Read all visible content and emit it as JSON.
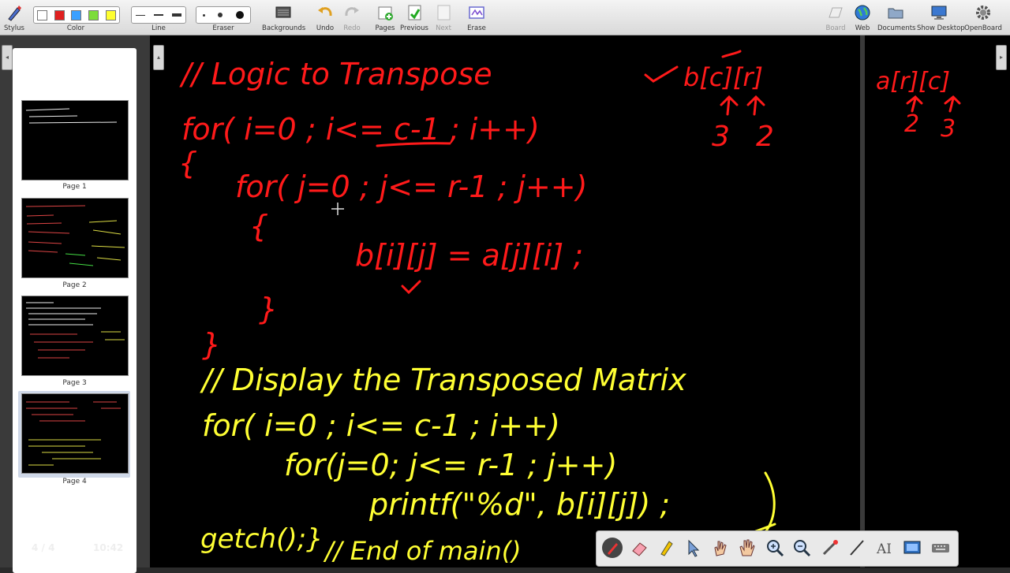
{
  "toolbar": {
    "stylus_label": "Stylus",
    "color_label": "Color",
    "line_label": "Line",
    "eraser_label": "Eraser",
    "backgrounds_label": "Backgrounds",
    "undo_label": "Undo",
    "redo_label": "Redo",
    "pages_label": "Pages",
    "previous_label": "Previous",
    "next_label": "Next",
    "erase_label": "Erase",
    "board_label": "Board",
    "web_label": "Web",
    "documents_label": "Documents",
    "show_desktop_label": "Show Desktop",
    "openboard_label": "OpenBoard",
    "colors": [
      "#ffffff",
      "#e02020",
      "#3aa0ff",
      "#7ddc3a",
      "#ffff30"
    ]
  },
  "pages_panel": {
    "thumbnails": [
      {
        "caption": "Page 1"
      },
      {
        "caption": "Page 2"
      },
      {
        "caption": "Page 3"
      },
      {
        "caption": "Page 4"
      }
    ],
    "page_counter": "4 / 4",
    "clock": "10:42"
  },
  "board": {
    "ink_red": "#ff1a1a",
    "ink_yellow": "#ffff33",
    "red_lines": [
      "// Logic to Transpose",
      "for( i=0 ; i<= c-1 ; i++)",
      "{",
      "for( j=0 ; j<= r-1 ; j++)",
      "{",
      "b[i][j] = a[j][i] ;",
      "}",
      "}"
    ],
    "red_note": [
      "b[c][r]",
      "3",
      "2"
    ],
    "yellow_lines": [
      "// Display the Transposed Matrix",
      "for( i=0 ; i<= c-1 ; i++)",
      "for(j=0; j<= r-1 ; j++)",
      "printf(\"%d\", b[i][j]) ;",
      "getch();}",
      "// End of main()"
    ]
  },
  "side_board": {
    "lines": [
      "a[r][c]",
      "2",
      "3"
    ]
  }
}
